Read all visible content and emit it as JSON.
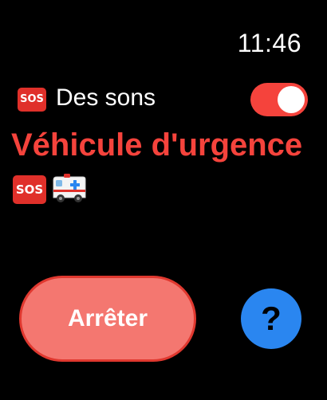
{
  "status_bar": {
    "time": "11:46"
  },
  "sound_toggle": {
    "badge": "SOS",
    "label": "Des sons",
    "state": "on",
    "color": "#f5433c"
  },
  "alert": {
    "title": "Véhicule d'urgence",
    "title_color": "#f5433c",
    "icons": [
      {
        "name": "sos-icon",
        "badge": "SOS"
      },
      {
        "name": "ambulance-icon"
      }
    ]
  },
  "actions": {
    "stop_label": "Arrêter",
    "stop_color": "#f47770",
    "help_label": "?",
    "help_color": "#2a86f0"
  }
}
